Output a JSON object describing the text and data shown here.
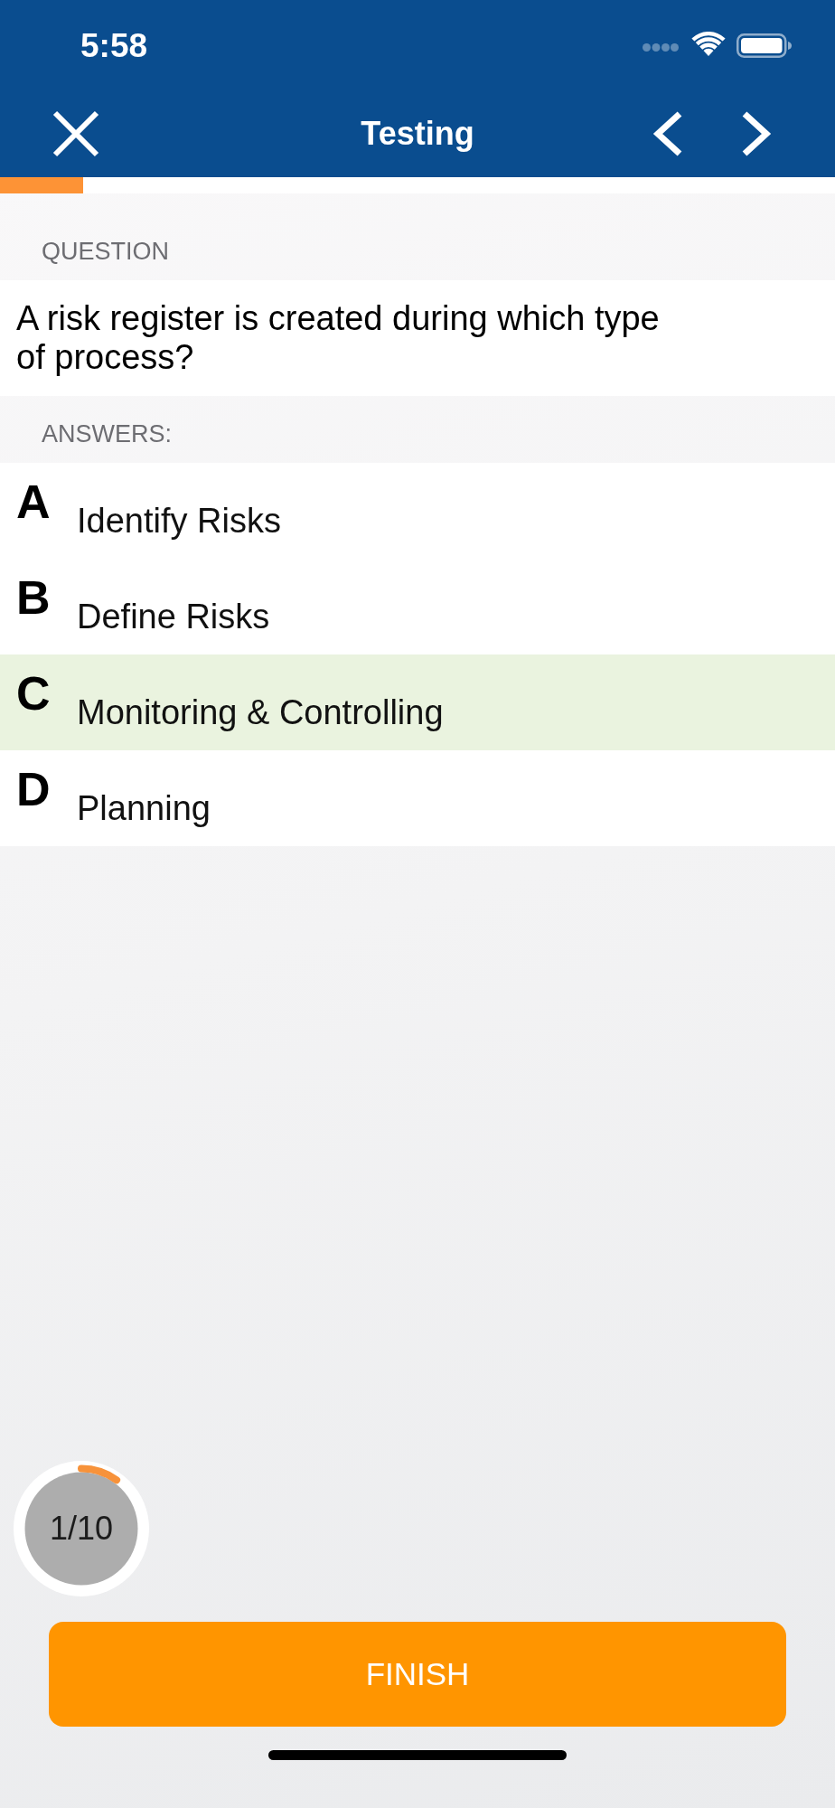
{
  "status_bar": {
    "time": "5:58"
  },
  "nav_bar": {
    "title": "Testing"
  },
  "progress": {
    "level": 0.1
  },
  "question": {
    "header": "QUESTION",
    "text": "A risk register is created during which type of process?"
  },
  "answers": {
    "header": "ANSWERS:",
    "options": [
      {
        "letter": "A",
        "text": "Identify Risks",
        "selected": false
      },
      {
        "letter": "B",
        "text": "Define Risks",
        "selected": false
      },
      {
        "letter": "C",
        "text": "Monitoring & Controlling",
        "selected": true
      },
      {
        "letter": "D",
        "text": "Planning",
        "selected": false
      }
    ]
  },
  "counter": {
    "text": "1/10",
    "level": 0.1
  },
  "finish_button": {
    "label": "FINISH"
  }
}
